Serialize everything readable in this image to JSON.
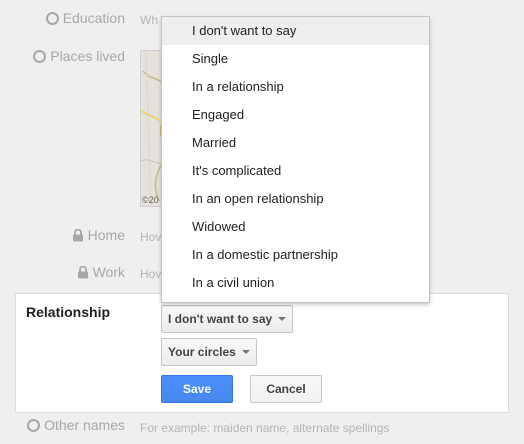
{
  "rows": {
    "education": {
      "label": "Education",
      "hint": "Wh"
    },
    "places_lived": {
      "label": "Places lived"
    },
    "home": {
      "label": "Home",
      "hint": "Hov"
    },
    "work": {
      "label": "Work",
      "hint": "Hov"
    },
    "other_names": {
      "label": "Other names",
      "hint": "For example: maiden name, alternate spellings"
    }
  },
  "map": {
    "credit": "©20"
  },
  "relationship": {
    "title": "Relationship",
    "status_value": "I don't want to say",
    "visibility_value": "Your circles",
    "save_label": "Save",
    "cancel_label": "Cancel"
  },
  "menu": {
    "items": [
      "I don't want to say",
      "Single",
      "In a relationship",
      "Engaged",
      "Married",
      "It's complicated",
      "In an open relationship",
      "Widowed",
      "In a domestic partnership",
      "In a civil union"
    ],
    "selected_index": 0
  },
  "colors": {
    "primary_button": "#4d90fe",
    "muted_text": "#a8a8a8",
    "page_background": "#efefef"
  }
}
